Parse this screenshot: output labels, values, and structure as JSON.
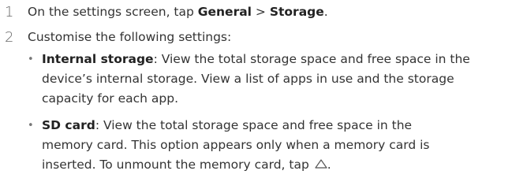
{
  "steps": [
    {
      "number": "1",
      "prefix": "On the settings screen, tap ",
      "path_part1": "General",
      "separator": " > ",
      "path_part2": "Storage",
      "suffix": "."
    },
    {
      "number": "2",
      "text": "Customise the following settings:"
    }
  ],
  "bullets": [
    {
      "marker": "•",
      "term": "Internal storage",
      "line1": ": View the total storage space and free space in the",
      "line2": "device’s internal storage. View a list of apps in use and the storage",
      "line3": "capacity for each app."
    },
    {
      "marker": "•",
      "term": "SD card",
      "line1": ": View the total storage space and free space in the",
      "line2": "memory card. This option appears only when a memory card is",
      "line3": "inserted. To unmount the memory card, tap ",
      "icon": "eject-icon",
      "end": "."
    }
  ]
}
